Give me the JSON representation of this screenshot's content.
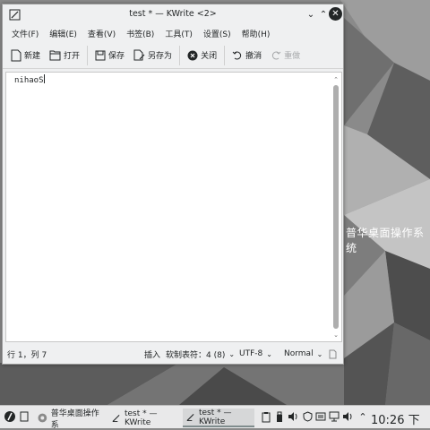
{
  "desktop": {
    "label": "普华桌面操作系统"
  },
  "window": {
    "title": "test * — KWrite <2>"
  },
  "menubar": {
    "items": [
      {
        "label": "文件(F)"
      },
      {
        "label": "编辑(E)"
      },
      {
        "label": "查看(V)"
      },
      {
        "label": "书签(B)"
      },
      {
        "label": "工具(T)"
      },
      {
        "label": "设置(S)"
      },
      {
        "label": "帮助(H)"
      }
    ]
  },
  "toolbar": {
    "new_label": "新建",
    "open_label": "打开",
    "save_label": "保存",
    "saveas_label": "另存为",
    "close_label": "关闭",
    "undo_label": "撤消",
    "redo_label": "重做"
  },
  "editor": {
    "content": "nihaoS"
  },
  "statusbar": {
    "position": "行 1，列 7",
    "mode": "插入",
    "tab_setting": "软制表符：4 (8)",
    "encoding": "UTF-8",
    "highlight": "Normal"
  },
  "taskbar": {
    "tasks": [
      {
        "label": "普华桌面操作系"
      },
      {
        "label": "test * — KWrite"
      },
      {
        "label": "test * — KWrite"
      }
    ],
    "clock": "10:26 下午"
  },
  "colors": {
    "window_bg": "#eff0f1",
    "editor_bg": "#ffffff",
    "taskbar_bg": "#e9e9ea",
    "text": "#232627"
  }
}
